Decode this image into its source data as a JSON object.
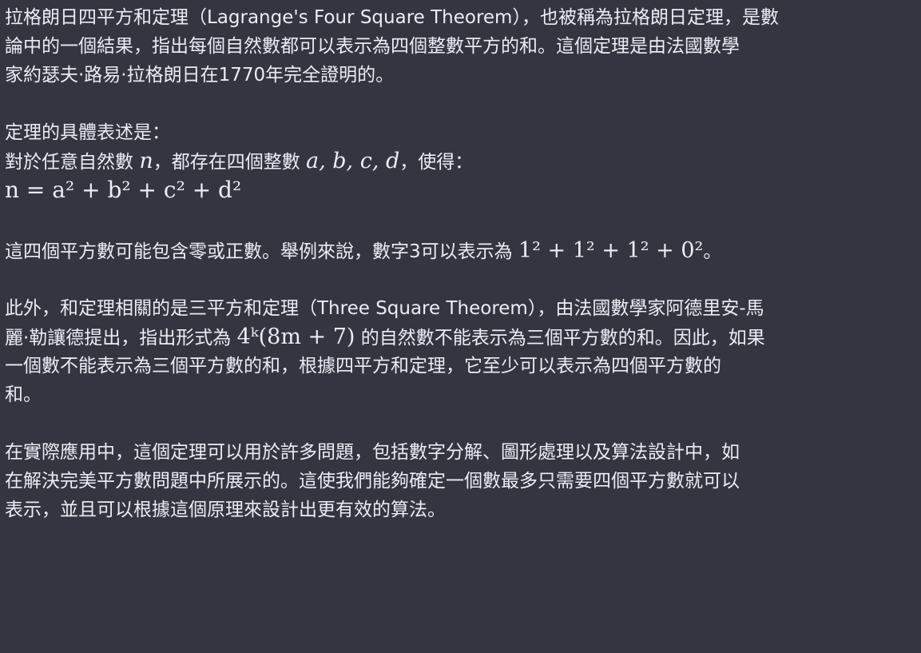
{
  "message": {
    "p1": {
      "line1": "拉格朗日四平方和定理（Lagrange's Four Square Theorem），也被稱為拉格朗日定理，是數",
      "line2": "論中的一個結果，指出每個自然數都可以表示為四個整數平方的和。這個定理是由法國數學",
      "line3": "家約瑟夫·路易·拉格朗日在1770年完全證明的。"
    },
    "p2": {
      "intro": "定理的具體表述是：",
      "stmt_pre": "對於任意自然數 ",
      "stmt_n": "n",
      "stmt_mid": "，都存在四個整數 ",
      "stmt_vars": "a, b, c, d",
      "stmt_post": "，使得：",
      "formula": "n = a² + b² + c² + d²"
    },
    "p3": {
      "text": "這四個平方數可能包含零或正數。舉例來說，數字3可以表示為 ",
      "example": "1² + 1² + 1² + 0²",
      "end": "。"
    },
    "p4": {
      "line1": "此外，和定理相關的是三平方和定理（Three Square Theorem），由法國數學家阿德里安-馬",
      "line2_pre": "麗·勒讓德提出，指出形式為 ",
      "line2_math": "4ᵏ(8m + 7)",
      "line2_post": " 的自然數不能表示為三個平方數的和。因此，如果",
      "line3": "一個數不能表示為三個平方數的和，根據四平方和定理，它至少可以表示為四個平方數的",
      "line4": "和。"
    },
    "p5": {
      "line1": "在實際應用中，這個定理可以用於許多問題，包括數字分解、圖形處理以及算法設計中，如",
      "line2": "在解決完美平方數問題中所展示的。這使我們能夠確定一個數最多只需要四個平方數就可以",
      "line3": "表示，並且可以根據這個原理來設計出更有效的算法。"
    }
  }
}
